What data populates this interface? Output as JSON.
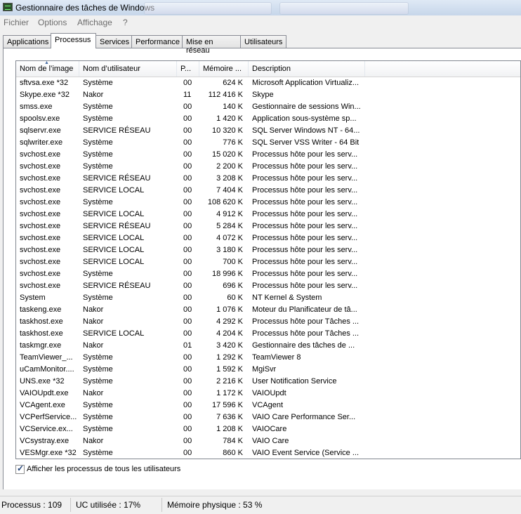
{
  "window": {
    "title": "Gestionnaire des tâches de Windows"
  },
  "menu": {
    "items": [
      "Fichier",
      "Options",
      "Affichage",
      "?"
    ]
  },
  "tabs": [
    "Applications",
    "Processus",
    "Services",
    "Performance",
    "Mise en réseau",
    "Utilisateurs"
  ],
  "active_tab": "Processus",
  "columns": [
    "Nom de l’image",
    "Nom d’utilisateur",
    "P...",
    "Mémoire ...",
    "Description"
  ],
  "processes": [
    [
      "sftvsa.exe *32",
      "Système",
      "00",
      "624 K",
      "Microsoft Application Virtualiz..."
    ],
    [
      "Skype.exe *32",
      "Nakor",
      "11",
      "112 416 K",
      "Skype"
    ],
    [
      "smss.exe",
      "Système",
      "00",
      "140 K",
      "Gestionnaire de sessions Win..."
    ],
    [
      "spoolsv.exe",
      "Système",
      "00",
      "1 420 K",
      "Application sous-système sp..."
    ],
    [
      "sqlservr.exe",
      "SERVICE RÉSEAU",
      "00",
      "10 320 K",
      "SQL Server Windows NT - 64..."
    ],
    [
      "sqlwriter.exe",
      "Système",
      "00",
      "776 K",
      "SQL Server VSS Writer - 64 Bit"
    ],
    [
      "svchost.exe",
      "Système",
      "00",
      "15 020 K",
      "Processus hôte pour les serv..."
    ],
    [
      "svchost.exe",
      "Système",
      "00",
      "2 200 K",
      "Processus hôte pour les serv..."
    ],
    [
      "svchost.exe",
      "SERVICE RÉSEAU",
      "00",
      "3 208 K",
      "Processus hôte pour les serv..."
    ],
    [
      "svchost.exe",
      "SERVICE LOCAL",
      "00",
      "7 404 K",
      "Processus hôte pour les serv..."
    ],
    [
      "svchost.exe",
      "Système",
      "00",
      "108 620 K",
      "Processus hôte pour les serv..."
    ],
    [
      "svchost.exe",
      "SERVICE LOCAL",
      "00",
      "4 912 K",
      "Processus hôte pour les serv..."
    ],
    [
      "svchost.exe",
      "SERVICE RÉSEAU",
      "00",
      "5 284 K",
      "Processus hôte pour les serv..."
    ],
    [
      "svchost.exe",
      "SERVICE LOCAL",
      "00",
      "4 072 K",
      "Processus hôte pour les serv..."
    ],
    [
      "svchost.exe",
      "SERVICE LOCAL",
      "00",
      "3 180 K",
      "Processus hôte pour les serv..."
    ],
    [
      "svchost.exe",
      "SERVICE LOCAL",
      "00",
      "700 K",
      "Processus hôte pour les serv..."
    ],
    [
      "svchost.exe",
      "Système",
      "00",
      "18 996 K",
      "Processus hôte pour les serv..."
    ],
    [
      "svchost.exe",
      "SERVICE RÉSEAU",
      "00",
      "696 K",
      "Processus hôte pour les serv..."
    ],
    [
      "System",
      "Système",
      "00",
      "60 K",
      "NT Kernel & System"
    ],
    [
      "taskeng.exe",
      "Nakor",
      "00",
      "1 076 K",
      "Moteur du Planificateur de tâ..."
    ],
    [
      "taskhost.exe",
      "Nakor",
      "00",
      "4 292 K",
      "Processus hôte pour Tâches ..."
    ],
    [
      "taskhost.exe",
      "SERVICE LOCAL",
      "00",
      "4 204 K",
      "Processus hôte pour Tâches ..."
    ],
    [
      "taskmgr.exe",
      "Nakor",
      "01",
      "3 420 K",
      "Gestionnaire des tâches de ..."
    ],
    [
      "TeamViewer_...",
      "Système",
      "00",
      "1 292 K",
      "TeamViewer 8"
    ],
    [
      "uCamMonitor....",
      "Système",
      "00",
      "1 592 K",
      "MgiSvr"
    ],
    [
      "UNS.exe *32",
      "Système",
      "00",
      "2 216 K",
      "User Notification Service"
    ],
    [
      "VAIOUpdt.exe",
      "Nakor",
      "00",
      "1 172 K",
      "VAIOUpdt"
    ],
    [
      "VCAgent.exe",
      "Système",
      "00",
      "17 596 K",
      "VCAgent"
    ],
    [
      "VCPerfService...",
      "Système",
      "00",
      "7 636 K",
      "VAIO Care Performance Ser..."
    ],
    [
      "VCService.ex...",
      "Système",
      "00",
      "1 208 K",
      "VAIOCare"
    ],
    [
      "VCsystray.exe",
      "Nakor",
      "00",
      "784 K",
      "VAIO Care"
    ],
    [
      "VESMgr.exe *32",
      "Système",
      "00",
      "860 K",
      "VAIO Event Service (Service ..."
    ]
  ],
  "show_all_users": {
    "label": "Afficher les processus de tous les utilisateurs",
    "checked": true
  },
  "status": {
    "processes": "Processus : 109",
    "cpu": "UC utilisée : 17%",
    "memory": "Mémoire physique : 53 %"
  },
  "icons": {
    "app": "task-manager-icon",
    "sort": "sort-ascending-icon",
    "check": "checkmark-icon"
  }
}
